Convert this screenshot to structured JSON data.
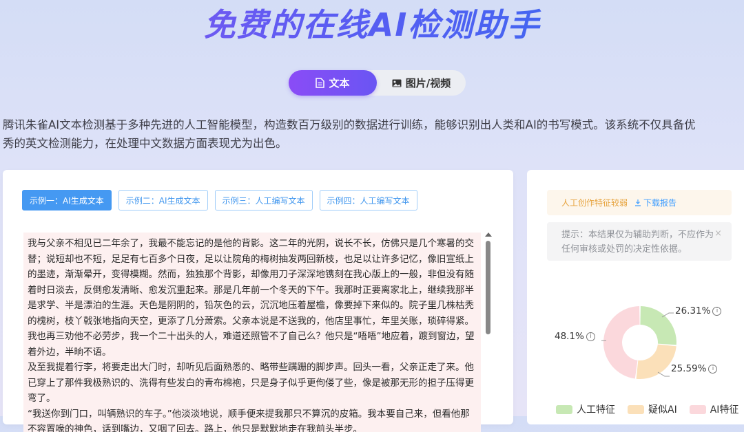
{
  "header": {
    "title": "免费的在线AI检测助手"
  },
  "tabs": [
    {
      "label": "文本",
      "icon": "document-icon",
      "active": true
    },
    {
      "label": "图片/视频",
      "icon": "image-icon",
      "active": false
    }
  ],
  "description": {
    "line1": "腾讯朱雀AI文本检测基于多种先进的人工智能模型，构造数百万级别的数据进行训练，能够识别出人类和AI的书写模式。该系统不仅具备优",
    "line2": "秀的英文检测能力，在处理中文数据方面表现尤为出色。"
  },
  "examples": [
    {
      "label": "示例一：AI生成文本",
      "active": true
    },
    {
      "label": "示例二：AI生成文本",
      "active": false
    },
    {
      "label": "示例三：人工编写文本",
      "active": false
    },
    {
      "label": "示例四：人工编写文本",
      "active": false
    }
  ],
  "sample_text": {
    "p1": "我与父亲不相见已二年余了，我最不能忘记的是他的背影。这二年的光阴，说长不长，仿佛只是几个寒暑的交替；说短却也不短，足足有七百多个日夜，足以让院角的梅树抽发两回新枝，也足以让许多记忆，像旧宣纸上的墨迹，渐渐晕开，变得模糊。然而，独独那个背影，却像用刀子深深地镌刻在我心版上的一般，非但没有随着时日淡去，反倒愈发清晰、愈发沉重起来。那是几年前一个冬天的下午。我那时正要离家北上，继续我那半是求学、半是漂泊的生涯。天色是阴阴的，铅灰色的云，沉沉地压着屋檐，像要掉下来似的。院子里几株枯秃的槐树，枝丫戟张地指向天空，更添了几分萧索。父亲本说是不送我的，他店里事忙，年里关账，琐碎得紧。我也再三劝他不必劳步，我一个二十出头的人，难道还照管不了自己么？他只是“唔唔”地应着，踱到窗边，望着外边，半晌不语。",
    "p2": "及至我提着行李，将要走出大门时，却听见后面熟悉的、略带些蹒跚的脚步声。回头一看，父亲正走了来。他已穿上了那件我极熟识的、洗得有些发白的青布棉袍，只是身子似乎更佝偻了些，像是被那无形的担子压得更弯了。",
    "p3": "“我送你到门口，叫辆熟识的车子。”他淡淡地说，顺手便来提我那只不算沉的皮箱。我本要自己来，但看他那不容置喙的神色，话到嘴边，又咽了回去。路上，他只是默默地走在我前头半步。"
  },
  "report": {
    "feature_label": "人工创作特征较弱",
    "download_label": "下载报告",
    "tip": "提示：本结果仅为辅助判断，不应作为任何审核或处罚的决定性依据。",
    "close_symbol": "×"
  },
  "chart_data": {
    "type": "pie",
    "categories": [
      "人工特征",
      "疑似AI",
      "AI特征"
    ],
    "values": [
      26.31,
      25.59,
      48.1
    ],
    "value_labels": [
      "26.31%",
      "25.59%",
      "48.1%"
    ],
    "colors": [
      "#c7e8b4",
      "#fbe0b9",
      "#fbd8dc"
    ],
    "donut": true,
    "legend_position": "bottom"
  }
}
